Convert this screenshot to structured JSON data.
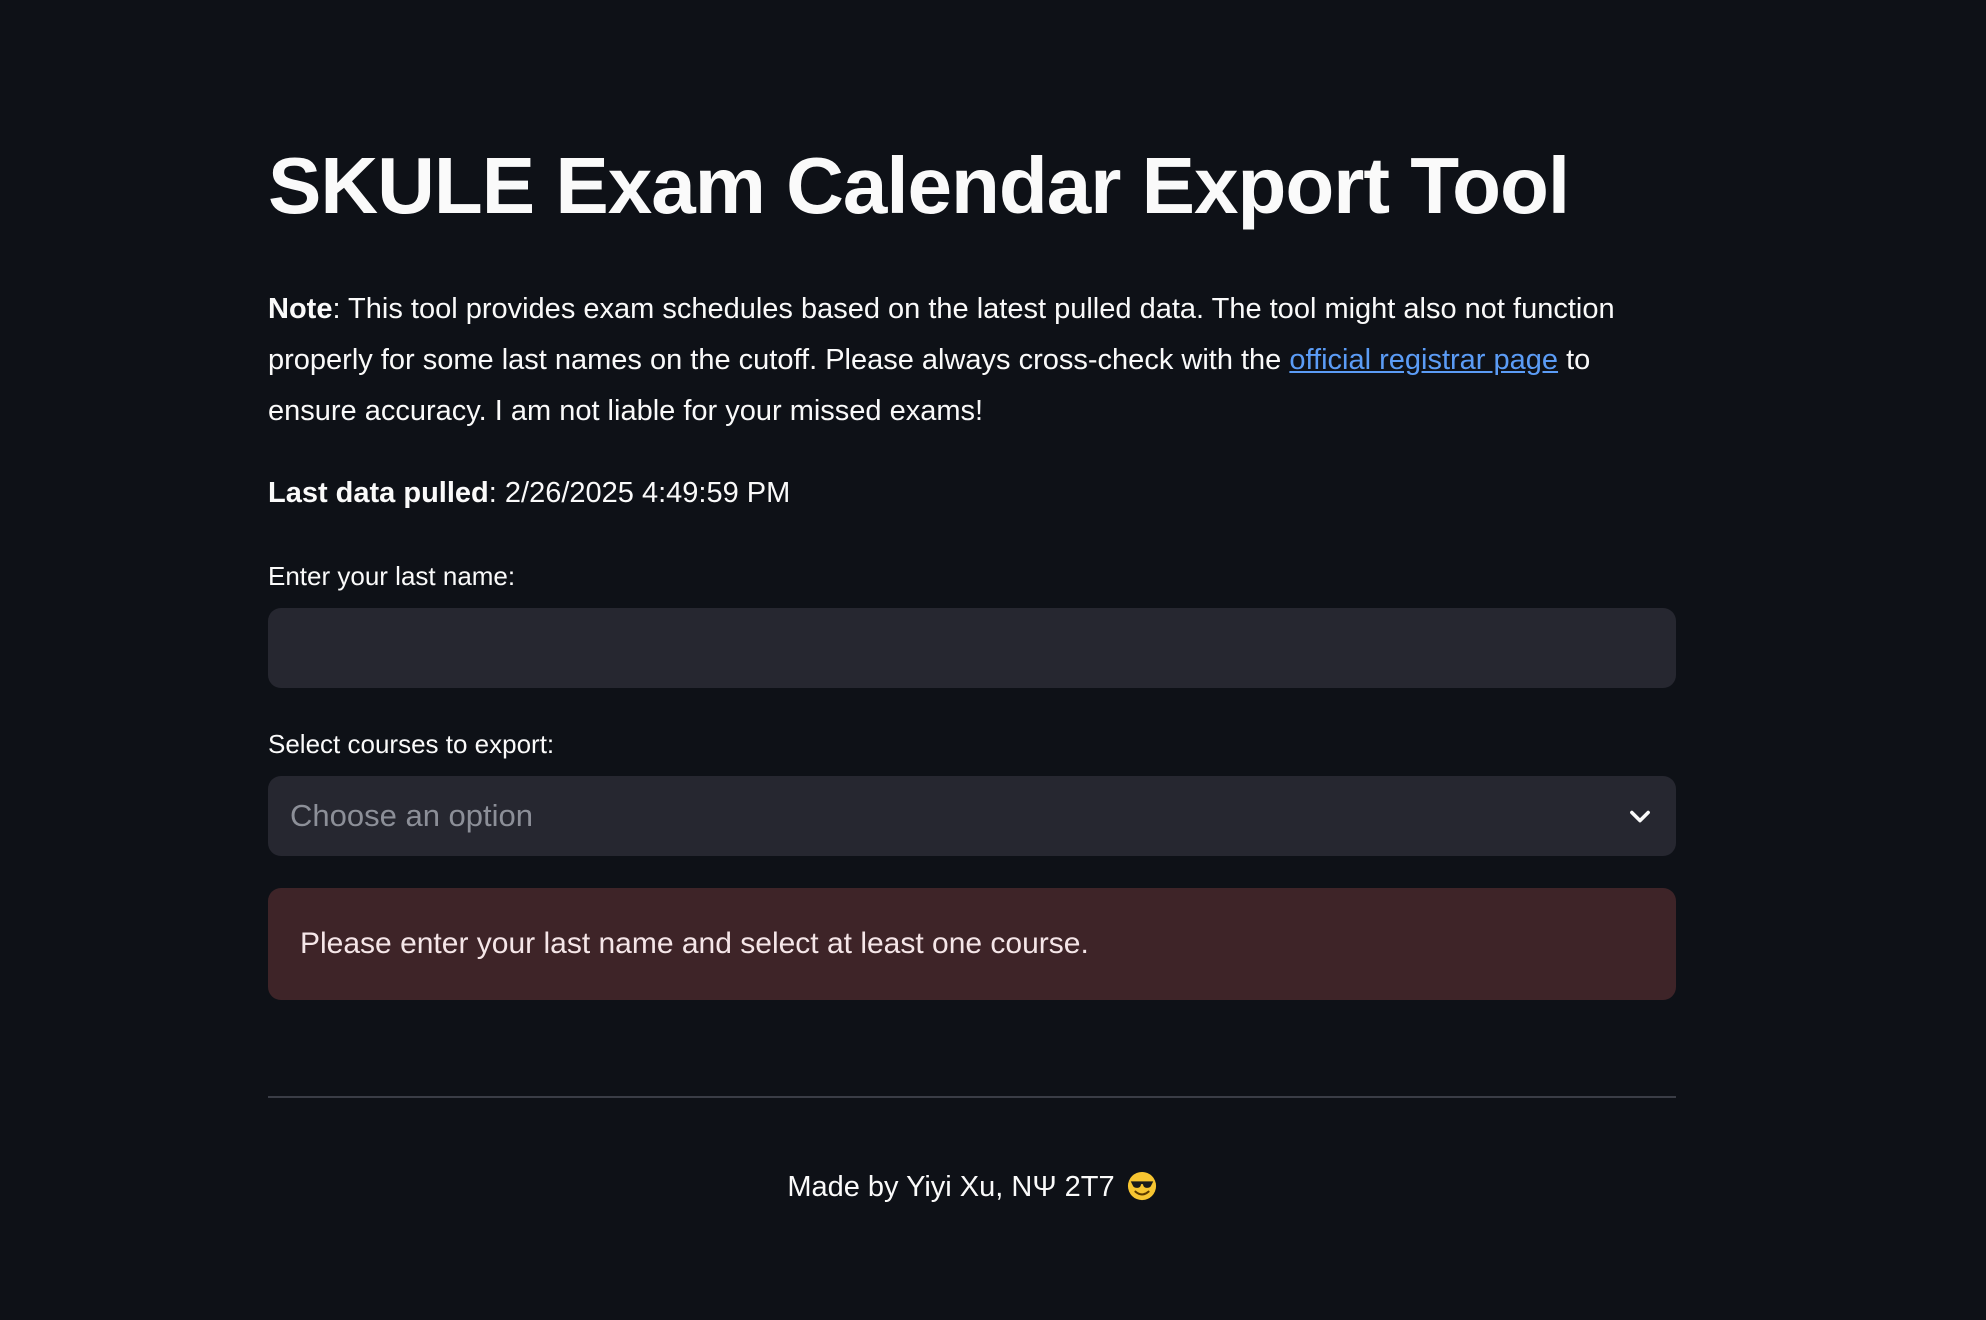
{
  "page": {
    "title": "SKULE Exam Calendar Export Tool"
  },
  "note": {
    "label": "Note",
    "text_before_link": ": This tool provides exam schedules based on the latest pulled data. The tool might also not function properly for some last names on the cutoff. Please always cross-check with the ",
    "link_text": "official registrar page",
    "text_after_link": " to ensure accuracy. I am not liable for your missed exams!"
  },
  "last_pulled": {
    "label": "Last data pulled",
    "value": ": 2/26/2025 4:49:59 PM"
  },
  "form": {
    "last_name_label": "Enter your last name:",
    "last_name_value": "",
    "courses_label": "Select courses to export:",
    "courses_placeholder": "Choose an option"
  },
  "alert": {
    "message": "Please enter your last name and select at least one course."
  },
  "footer": {
    "text": "Made by Yiyi Xu, NΨ 2T7",
    "emoji_icon": "smiling-face-with-sunglasses-icon"
  },
  "colors": {
    "background": "#0e1117",
    "input_background": "#262730",
    "link": "#5b9cf6",
    "alert_background": "#3e2428"
  }
}
